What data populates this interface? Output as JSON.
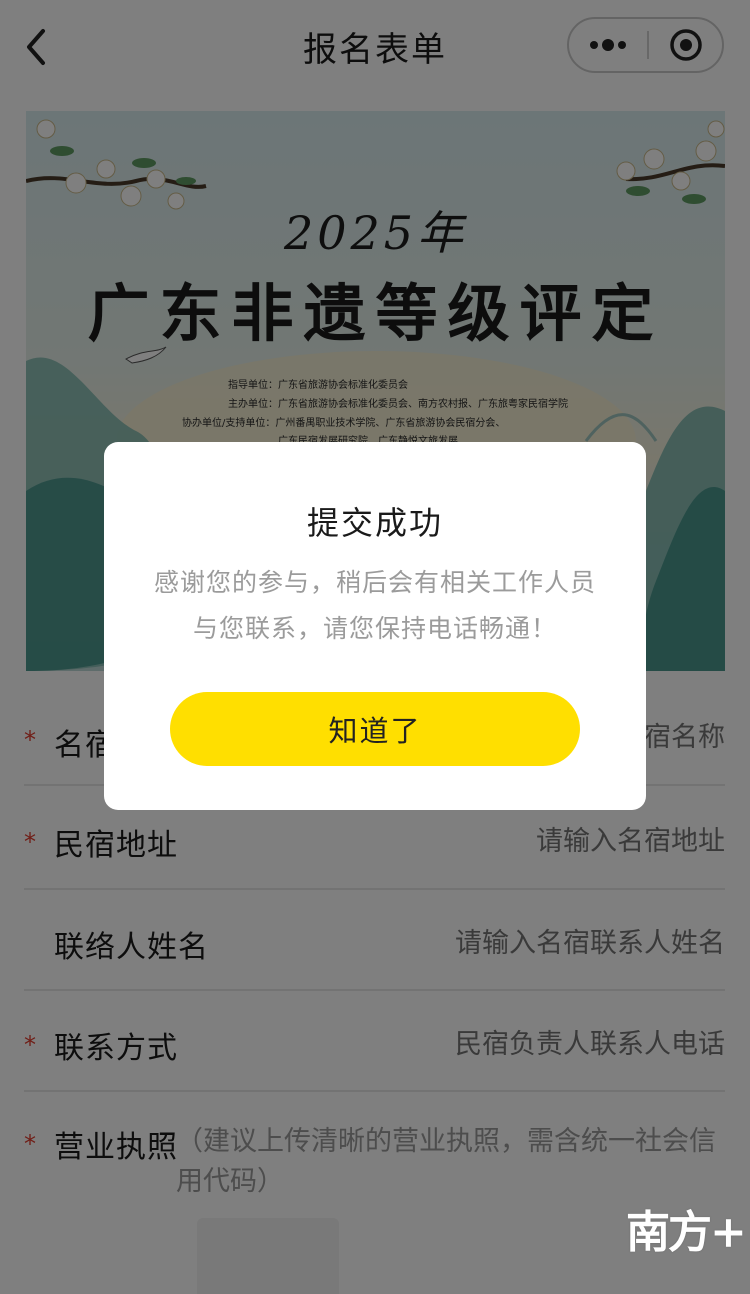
{
  "nav": {
    "title": "报名表单"
  },
  "banner": {
    "year": "2025年",
    "title": "广东非遗等级评定",
    "org_lines": [
      "指导单位：广东省旅游协会标准化委员会",
      "主办单位：广东省旅游协会标准化委员会、南方农村报、广东旅粤家民宿学院",
      "协办单位/支持单位：广州番禺职业技术学院、广东省旅游协会民宿分会、",
      "广东民宿发展研究院、广东静悦文旅发展"
    ]
  },
  "form": {
    "fields": [
      {
        "label": "名宿名称",
        "required": true,
        "placeholder": "请输入名宿名称"
      },
      {
        "label": "民宿地址",
        "required": true,
        "placeholder": "请输入名宿地址"
      },
      {
        "label": "联络人姓名",
        "required": false,
        "placeholder": "请输入名宿联系人姓名"
      },
      {
        "label": "联系方式",
        "required": true,
        "placeholder": "民宿负责人联系人电话"
      }
    ],
    "license": {
      "label": "营业执照",
      "required": true,
      "hint": "（建议上传清晰的营业执照，需含统一社会信用代码）"
    },
    "required_mark": "*"
  },
  "dialog": {
    "title": "提交成功",
    "message_line1": "感谢您的参与，稍后会有相关工作人员",
    "message_line2": "与您联系，请您保持电话畅通！",
    "confirm_label": "知道了"
  },
  "watermark": {
    "text": "南方+"
  },
  "colors": {
    "accent_button": "#ffdf00",
    "required_mark": "#e03c2e",
    "overlay": "rgba(0,0,0,0.5)"
  },
  "icons": [
    "back-arrow-icon",
    "more-dots-icon",
    "close-target-icon",
    "camera-icon"
  ]
}
